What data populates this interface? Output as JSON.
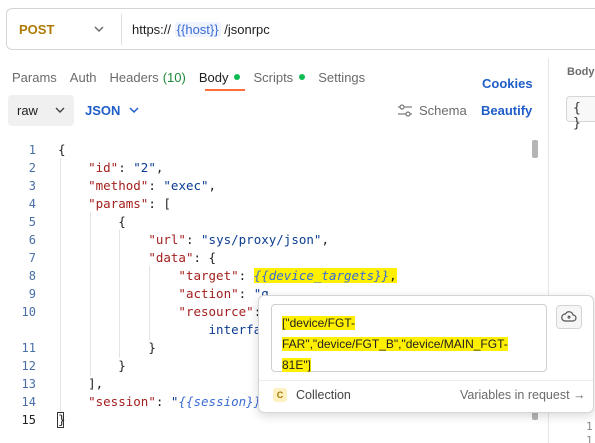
{
  "request": {
    "method": "POST",
    "url_prefix": "https://",
    "url_variable": "{{host}}",
    "url_suffix": "/jsonrpc"
  },
  "tabs": [
    {
      "label": "Params"
    },
    {
      "label": "Auth"
    },
    {
      "label": "Headers",
      "count": "(10)"
    },
    {
      "label": "Body",
      "active": true
    },
    {
      "label": "Scripts"
    },
    {
      "label": "Settings"
    }
  ],
  "cookies_label": "Cookies",
  "right_panel": {
    "title": "Body",
    "braces": "{ }",
    "lines": [
      "1",
      "1"
    ]
  },
  "body_toolbar": {
    "mode": "raw",
    "language": "JSON",
    "schema_label": "Schema",
    "beautify_label": "Beautify"
  },
  "line_numbers": [
    "1",
    "2",
    "3",
    "4",
    "5",
    "6",
    "7",
    "8",
    "9",
    "10",
    "11",
    "12",
    "13",
    "14",
    "15"
  ],
  "code": {
    "l1": "{",
    "id_key": "\"id\"",
    "id_val": "\"2\"",
    "method_key": "\"method\"",
    "method_val": "\"exec\"",
    "params_key": "\"params\"",
    "params_open": "[",
    "obj_open": "{",
    "url_key": "\"url\"",
    "url_val": "\"sys/proxy/json\"",
    "data_key": "\"data\"",
    "data_open": "{",
    "target_key": "\"target\"",
    "target_val": "{{device_targets}}",
    "action_key": "\"action\"",
    "action_val_partial": "\"g",
    "resource_key": "\"resource\"",
    "resource_cont": "interfac",
    "data_close": "}",
    "obj_close": "}",
    "params_close": "],",
    "session_key": "\"session\"",
    "session_val": "{{session}}",
    "l15": "}"
  },
  "popover": {
    "value_lines": [
      "[\"device/FGT-",
      "FAR\",\"device/FGT_B\",\"device/MAIN_FGT-",
      "81E\"]"
    ],
    "badge": "C",
    "collection_label": "Collection",
    "link_label": "Variables in request →"
  },
  "colors": {
    "accent": "#ff6c37",
    "link": "#1f5ec8",
    "highlight": "#ffef00",
    "method": "#ad7a03"
  }
}
